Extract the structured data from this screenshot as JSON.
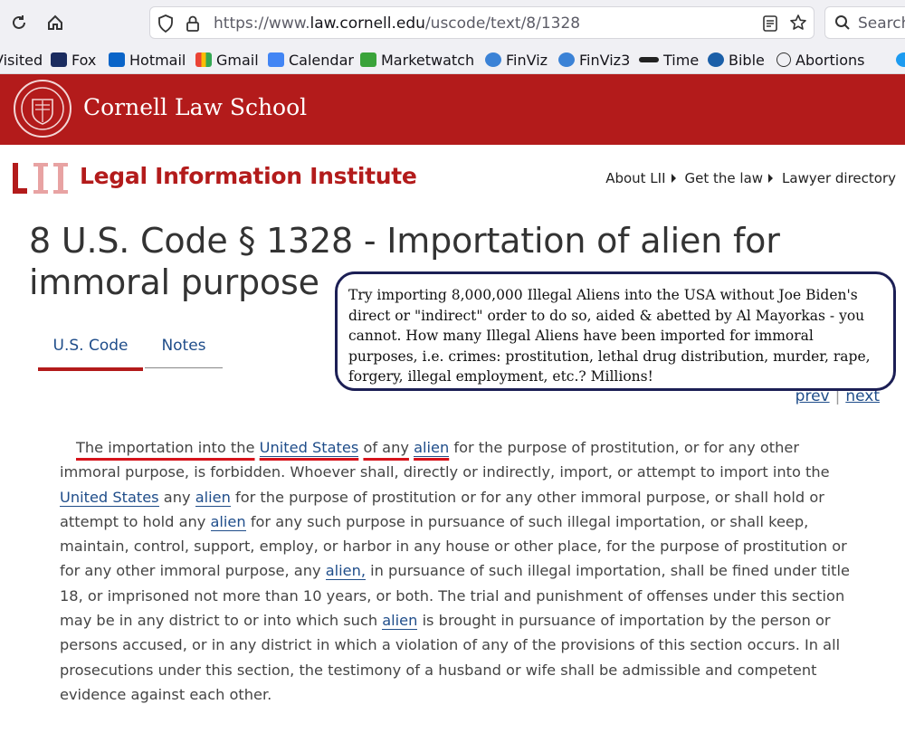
{
  "browser": {
    "url_prefix": "https://www.",
    "url_domain": "law.cornell.edu",
    "url_path": "/uscode/text/8/1328",
    "search_placeholder": "Search"
  },
  "bookmarks": [
    {
      "label": "Visited",
      "icon": "none"
    },
    {
      "label": "Fox",
      "icon": "fox-news-icon"
    },
    {
      "label": "Hotmail",
      "icon": "outlook-icon"
    },
    {
      "label": "Gmail",
      "icon": "gmail-icon"
    },
    {
      "label": "Calendar",
      "icon": "calendar-icon"
    },
    {
      "label": "Marketwatch",
      "icon": "marketwatch-icon"
    },
    {
      "label": "FinViz",
      "icon": "facebook-icon"
    },
    {
      "label": "FinViz3",
      "icon": "facebook-icon"
    },
    {
      "label": "Time",
      "icon": "nist-icon"
    },
    {
      "label": "Bible",
      "icon": "bible-icon"
    },
    {
      "label": "Abortions",
      "icon": "globe-icon"
    }
  ],
  "banner": {
    "title": "Cornell Law School"
  },
  "lii": {
    "title": "Legal Information Institute",
    "nav": [
      "About LII",
      "Get the law",
      "Lawyer directory"
    ]
  },
  "page": {
    "title": "8 U.S. Code § 1328 - Importation of alien for immoral purpose",
    "tabs": [
      "U.S. Code",
      "Notes"
    ],
    "prev": "prev",
    "next": "next"
  },
  "annotation": "Try importing 8,000,000 Illegal Aliens into the USA without Joe Biden's direct or \"indirect\" order to do so, aided & abetted by Al Mayorkas - you cannot.  How many Illegal Aliens have been imported for immoral purposes, i.e. crimes: prostitution, lethal drug distribution, murder, rape, forgery, illegal employment, etc.?  Millions!",
  "statute": {
    "s1": "The importation into the",
    "l1": "United States",
    "s2": "of any",
    "l2": "alien",
    "s3": "for the purpose of prostitution, or for any other immoral purpose, is forbidden. Whoever shall, directly or indirectly, import, or attempt to import into the",
    "l3": "United States",
    "s4": "any",
    "l4": "alien",
    "s5": "for the purpose of prostitution or for any other immoral purpose, or shall hold or attempt to hold any",
    "l5": "alien",
    "s6": "for any such purpose in pursuance of such illegal importation, or shall keep, maintain, control, support, employ, or harbor in any house or other place, for the purpose of prostitution or for any other immoral purpose, any",
    "l6": "alien,",
    "s7": "in pursuance of such illegal importation, shall be fined under title 18, or imprisoned not more than 10 years, or both. The trial and punishment of offenses under this section may be in any district to or into which such",
    "l7": "alien",
    "s8": "is brought in pursuance of importation by the person or persons accused, or in any district in which a violation of any of the provisions of this section occurs. In all prosecutions under this section, the testimony of a husband or wife shall be admissible and competent evidence against each other."
  }
}
